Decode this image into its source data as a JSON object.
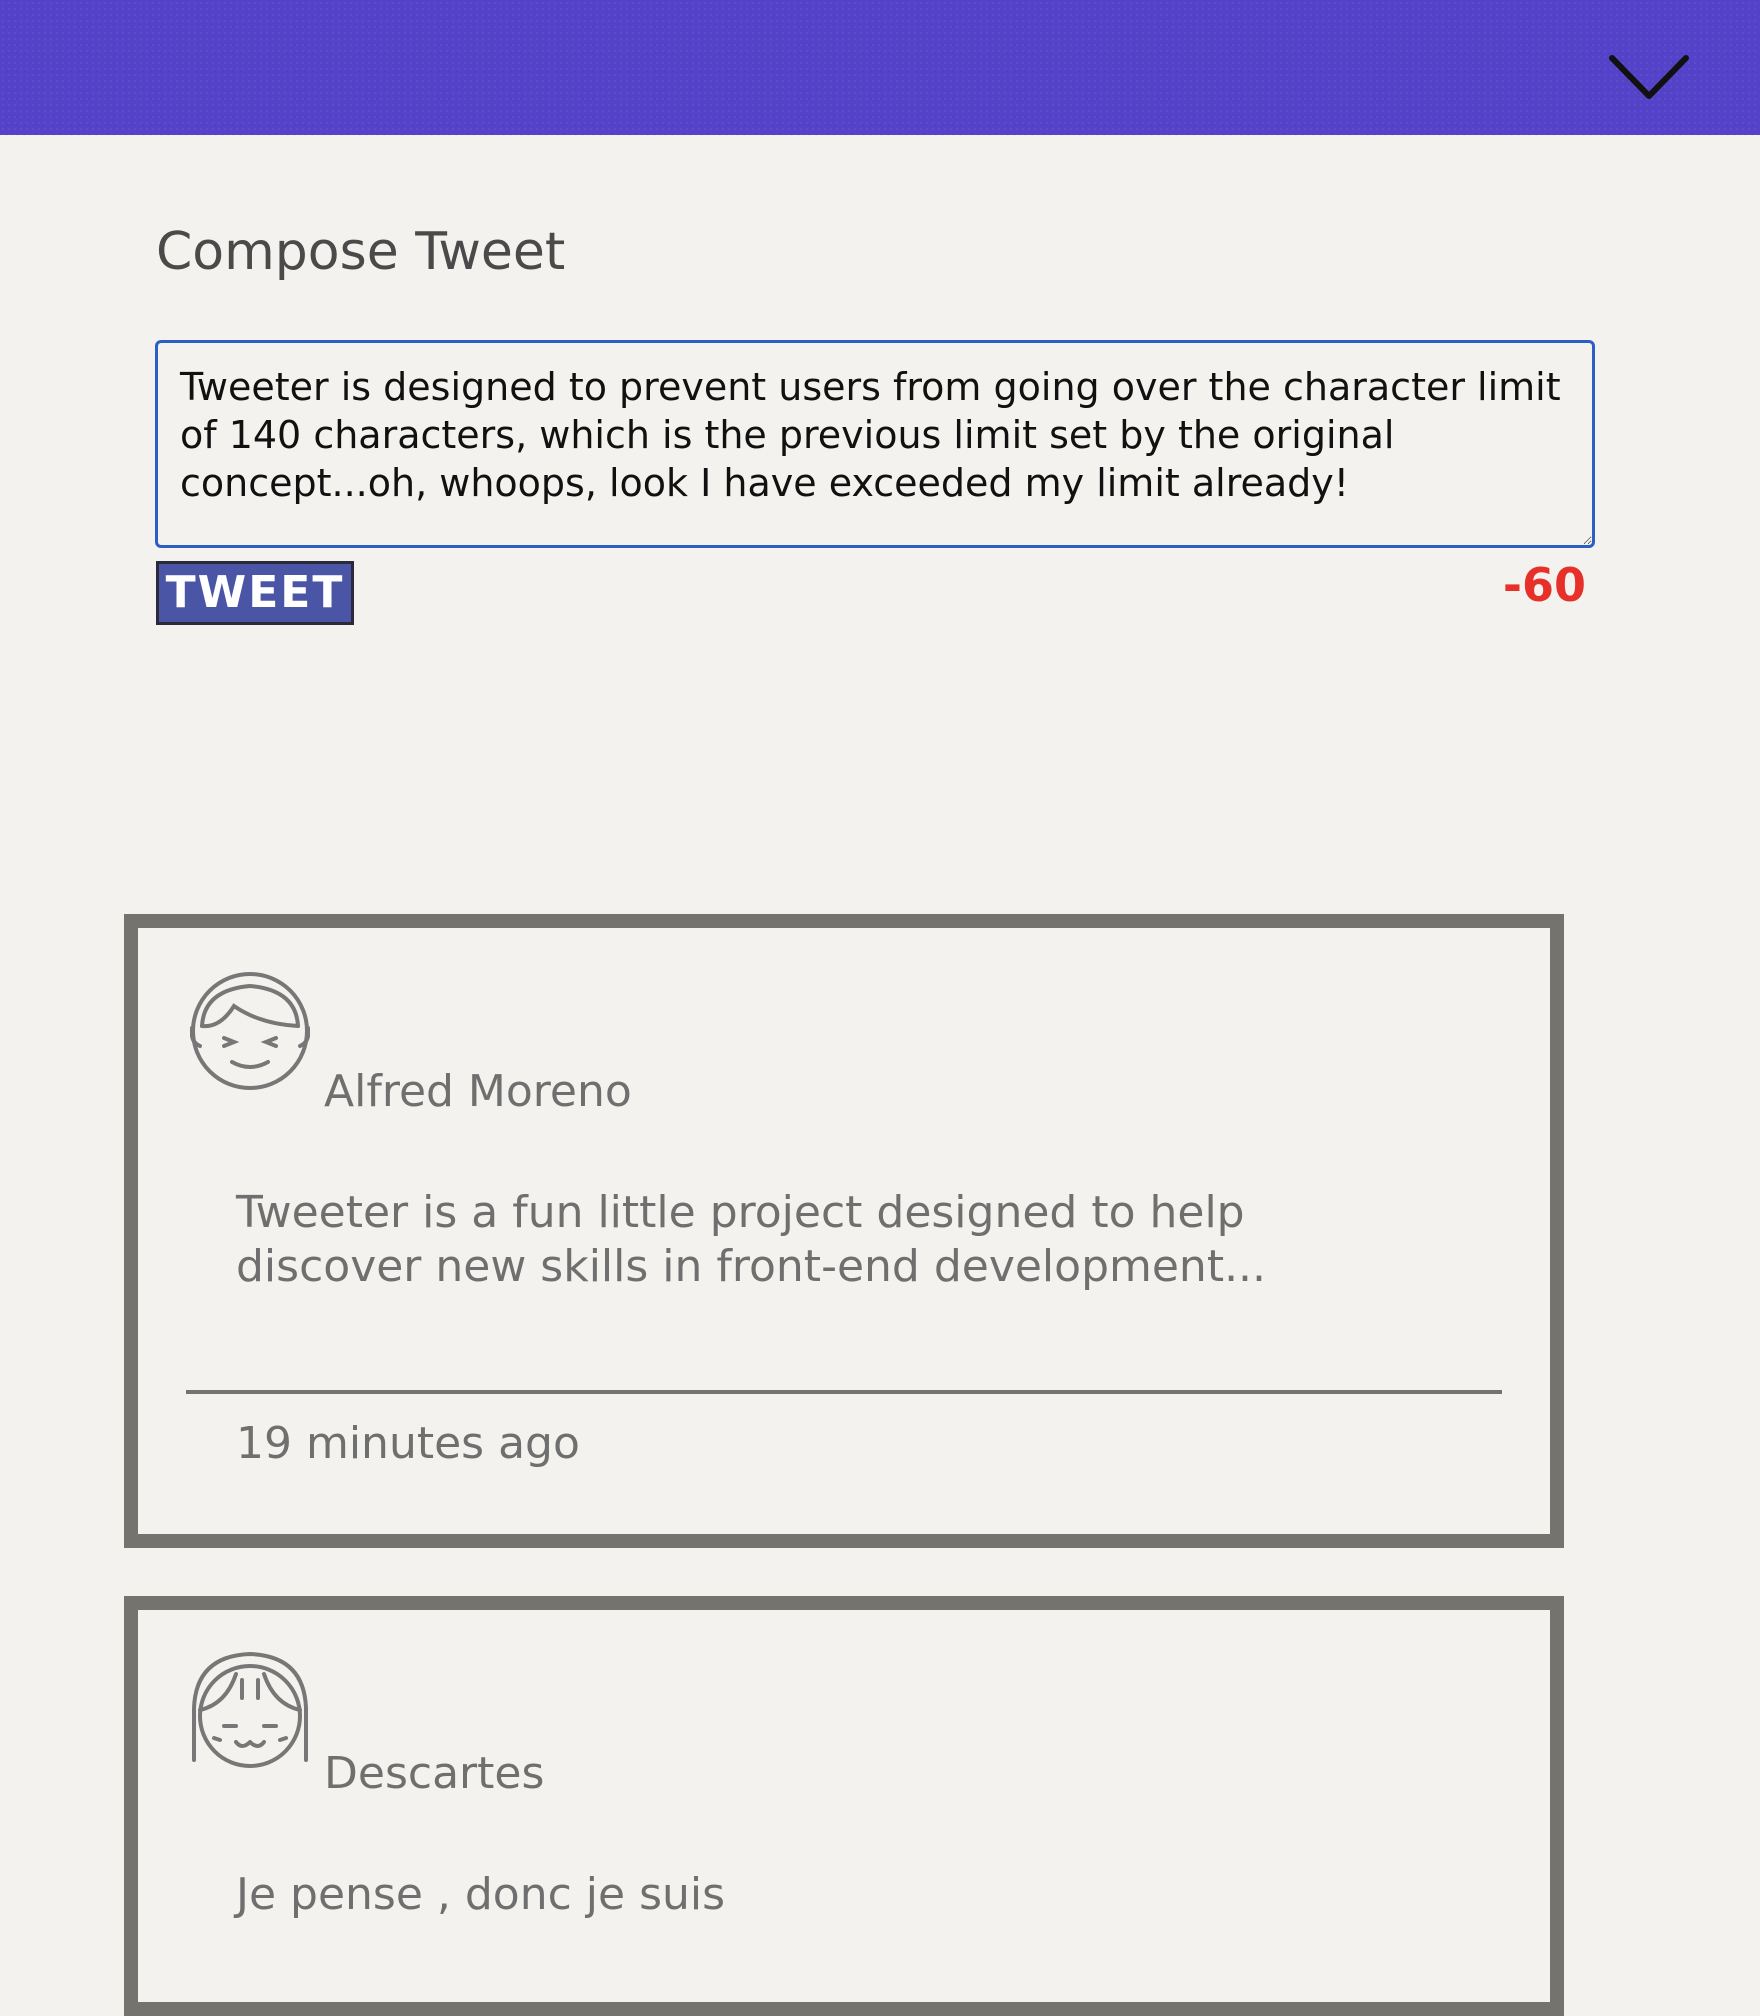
{
  "header": {
    "menu_icon": "chevron-down-icon"
  },
  "compose": {
    "title": "Compose Tweet",
    "text": "Tweeter is designed to prevent users from going over the character limit of 140 characters, which is the previous limit set by the original concept...oh, whoops, look I have exceeded my limit already!",
    "button_label": "TWEET",
    "counter": "-60"
  },
  "tweets": [
    {
      "author": "Alfred Moreno",
      "avatar_icon": "boy-avatar-icon",
      "text": "Tweeter is a fun little project designed to help discover new skills in front-end development...",
      "time": "19 minutes ago"
    },
    {
      "author": "Descartes",
      "avatar_icon": "girl-avatar-icon",
      "text": "Je pense , donc je suis"
    }
  ],
  "colors": {
    "header": "#5443c9",
    "button": "#4a55a5",
    "counter_over": "#e8302a",
    "card_border": "#75736e",
    "input_border": "#2b5fc4"
  }
}
